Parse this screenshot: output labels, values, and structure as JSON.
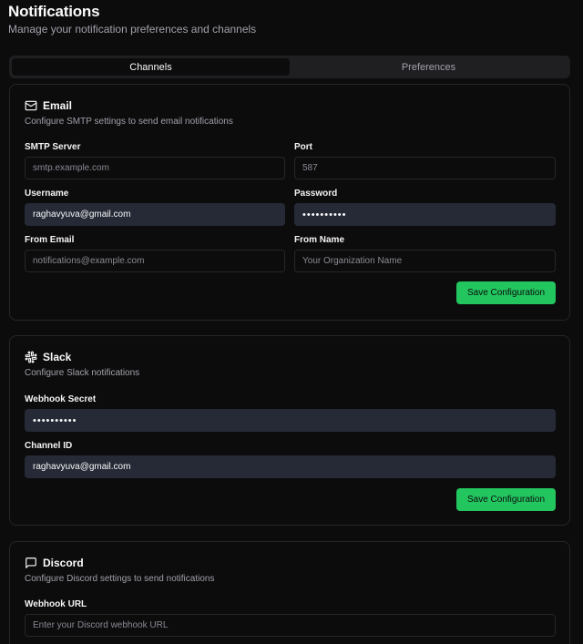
{
  "header": {
    "title": "Notifications",
    "subtitle": "Manage your notification preferences and channels"
  },
  "tabs": [
    {
      "label": "Channels",
      "active": true
    },
    {
      "label": "Preferences",
      "active": false
    }
  ],
  "email": {
    "title": "Email",
    "icon": "mail-icon",
    "description": "Configure SMTP settings to send email notifications",
    "smtp_server": {
      "label": "SMTP Server",
      "value": "",
      "placeholder": "smtp.example.com"
    },
    "port": {
      "label": "Port",
      "value": "",
      "placeholder": "587"
    },
    "username": {
      "label": "Username",
      "value": "raghavyuva@gmail.com",
      "placeholder": ""
    },
    "password": {
      "label": "Password",
      "value": "••••••••••",
      "placeholder": ""
    },
    "from_email": {
      "label": "From Email",
      "value": "",
      "placeholder": "notifications@example.com"
    },
    "from_name": {
      "label": "From Name",
      "value": "",
      "placeholder": "Your Organization Name"
    },
    "save_label": "Save Configuration"
  },
  "slack": {
    "title": "Slack",
    "icon": "slack-icon",
    "description": "Configure Slack notifications",
    "webhook_secret": {
      "label": "Webhook Secret",
      "value": "••••••••••",
      "placeholder": ""
    },
    "channel_id": {
      "label": "Channel ID",
      "value": "raghavyuva@gmail.com",
      "placeholder": ""
    },
    "save_label": "Save Configuration"
  },
  "discord": {
    "title": "Discord",
    "icon": "message-square-icon",
    "description": "Configure Discord settings to send notifications",
    "webhook_url": {
      "label": "Webhook URL",
      "value": "",
      "placeholder": "Enter your Discord webhook URL"
    }
  },
  "colors": {
    "background": "#0c0c0d",
    "accent": "#22c55e",
    "filled_input": "#252a36"
  }
}
